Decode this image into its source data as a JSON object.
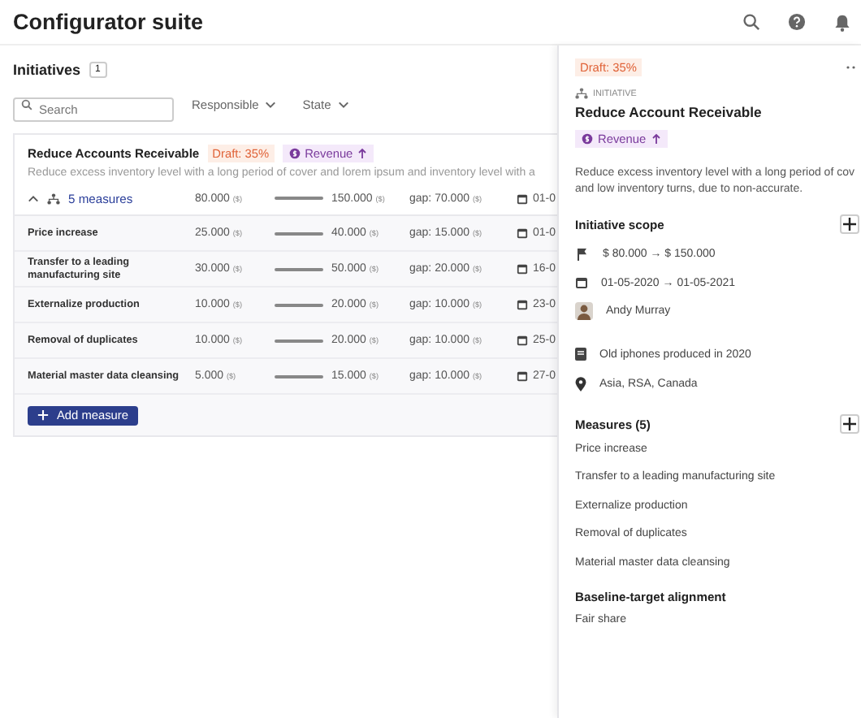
{
  "app": {
    "title": "Configurator suite"
  },
  "initiatives": {
    "heading": "Initiatives",
    "count": "1",
    "search": {
      "placeholder": "Search"
    },
    "filters": [
      "Responsible",
      "State"
    ],
    "card": {
      "title": "Reduce Accounts Receivable",
      "status": "Draft: 35%",
      "tag": "Revenue",
      "description": "Reduce excess inventory level with a long period of cover and lorem ipsum and inventory level with a",
      "measures_toggle": {
        "label": "5 measures",
        "expanded": true
      },
      "summary": {
        "baseline": {
          "value": "80.000",
          "unit": "($)"
        },
        "target": {
          "value": "150.000",
          "unit": "($)"
        },
        "gap": {
          "value": "gap: 70.000",
          "unit": "($)"
        },
        "date": "01-0"
      },
      "rows": [
        {
          "name": "Price increase",
          "baseline": {
            "value": "25.000",
            "unit": "($)"
          },
          "target": {
            "value": "40.000",
            "unit": "($)"
          },
          "gap": {
            "value": "gap: 15.000",
            "unit": "($)"
          },
          "date": "01-0"
        },
        {
          "name": "Transfer to a leading manufacturing site",
          "baseline": {
            "value": "30.000",
            "unit": "($)"
          },
          "target": {
            "value": "50.000",
            "unit": "($)"
          },
          "gap": {
            "value": "gap: 20.000",
            "unit": "($)"
          },
          "date": "16-0"
        },
        {
          "name": "Externalize production",
          "baseline": {
            "value": "10.000",
            "unit": "($)"
          },
          "target": {
            "value": "20.000",
            "unit": "($)"
          },
          "gap": {
            "value": "gap: 10.000",
            "unit": "($)"
          },
          "date": "23-0"
        },
        {
          "name": "Removal of duplicates",
          "baseline": {
            "value": "10.000",
            "unit": "($)"
          },
          "target": {
            "value": "20.000",
            "unit": "($)"
          },
          "gap": {
            "value": "gap: 10.000",
            "unit": "($)"
          },
          "date": "25-0"
        },
        {
          "name": "Material master data cleansing",
          "baseline": {
            "value": "5.000",
            "unit": "($)"
          },
          "target": {
            "value": "15.000",
            "unit": "($)"
          },
          "gap": {
            "value": "gap: 10.000",
            "unit": "($)"
          },
          "date": "27-0"
        }
      ],
      "add_button": "Add measure"
    }
  },
  "detail": {
    "status": "Draft: 35%",
    "type": "INITIATIVE",
    "title": "Reduce Account Receivable",
    "tag": "Revenue",
    "description_lines": [
      "Reduce excess inventory level with a long period of cov",
      "and low inventory turns, due to non-accurate."
    ],
    "scope": {
      "heading": "Initiative scope",
      "items": [
        {
          "kind": "budget",
          "text": "$ 80.000 → $ 150.000"
        },
        {
          "kind": "dates",
          "text": "01-05-2020 → 01-05-2021"
        },
        {
          "kind": "owner",
          "text": "Andy Murray"
        },
        {
          "kind": "product",
          "text": "Old iphones produced in 2020"
        },
        {
          "kind": "location",
          "text": "Asia, RSA, Canada"
        }
      ]
    },
    "measures": {
      "heading": "Measures (5)",
      "items": [
        "Price increase",
        "Transfer to a leading manufacturing site",
        "Externalize production",
        "Removal of duplicates",
        "Material master data cleansing"
      ]
    },
    "alignment": {
      "heading": "Baseline-target alignment",
      "value": "Fair share"
    }
  }
}
